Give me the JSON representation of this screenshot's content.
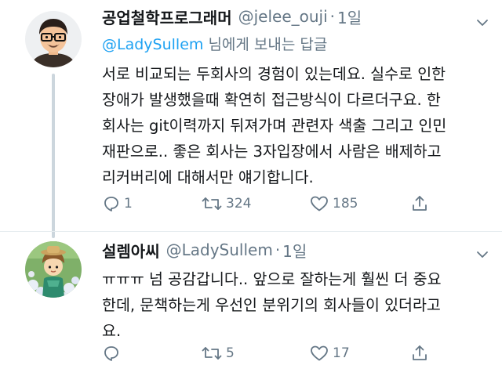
{
  "colors": {
    "link": "#1da1f2",
    "secondary_text": "#657786",
    "primary_text": "#14171a",
    "thread_line": "#ccd6dd"
  },
  "tweets": [
    {
      "name": "공업철학프로그래머",
      "handle": "@jelee_ouji",
      "separator": "·",
      "time": "1일",
      "reply_mention": "@LadySullem",
      "reply_suffix": " 님에게 보내는 답글",
      "text": "서로 비교되는 두회사의 경험이 있는데요. 실수로 인한\n장애가 발생했을때 확연히 접근방식이 다르더구요. 한\n회사는 git이력까지 뒤져가며 관련자 색출 그리고 인민\n재판으로.. 좋은 회사는 3자입장에서 사람은 배제하고\n리커버리에 대해서만 얘기합니다.",
      "avatar_icon": "cartoon-man-glasses-avatar",
      "actions": {
        "reply_count": "1",
        "retweet_count": "324",
        "like_count": "185"
      }
    },
    {
      "name": "설렘아씨",
      "handle": "@LadySullem",
      "separator": "·",
      "time": "1일",
      "text": "ㅠㅠㅠ 넘 공감갑니다.. 앞으로 잘하는게 훨씬 더 중요\n한데, 문책하는게 우선인 분위기의 회사들이 있더라고\n요.",
      "avatar_icon": "garden-character-avatar",
      "actions": {
        "reply_count": "",
        "retweet_count": "5",
        "like_count": "17"
      }
    }
  ]
}
